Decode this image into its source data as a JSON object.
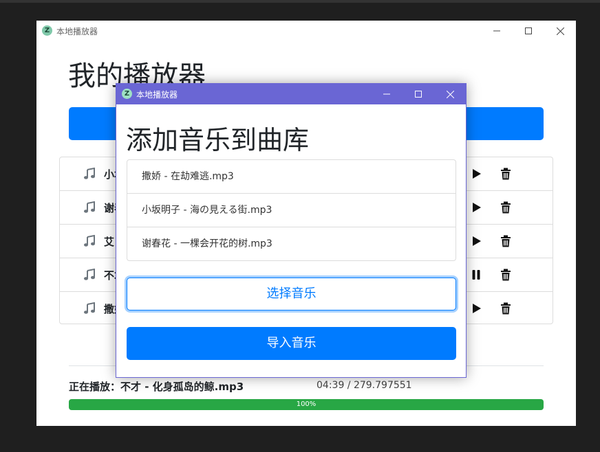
{
  "main_window": {
    "title": "本地播放器",
    "heading": "我的播放器",
    "songs": [
      {
        "title": "小坂明子 - 海の見える街.mp3",
        "state": "play"
      },
      {
        "title": "谢春花 - 一棵会开花的树.mp3",
        "state": "play"
      },
      {
        "title": "艾",
        "state": "play"
      },
      {
        "title": "不才 - 化身孤岛的鲸.mp3",
        "state": "pause"
      },
      {
        "title": "撒娇 - 在劫难逃.mp3",
        "state": "play"
      }
    ],
    "now_playing": "正在播放：不才 - 化身孤岛的鲸.mp3",
    "time": "04:39 / 279.797551",
    "progress_label": "100%",
    "progress_value": 100
  },
  "dialog": {
    "title": "本地播放器",
    "heading": "添加音乐到曲库",
    "files": [
      "撒娇 - 在劫难逃.mp3",
      "小坂明子 - 海の見える街.mp3",
      "谢春花 - 一棵会开花的树.mp3"
    ],
    "select_button": "选择音乐",
    "import_button": "导入音乐"
  },
  "icons": {
    "logo": "z-logo-icon",
    "minimize": "minimize-icon",
    "maximize": "maximize-icon",
    "close": "close-icon",
    "note": "music-note-icon",
    "play": "play-icon",
    "pause": "pause-icon",
    "trash": "trash-icon"
  },
  "colors": {
    "primary": "#007bff",
    "success": "#28a745",
    "dialog_titlebar": "#6a66d4"
  }
}
